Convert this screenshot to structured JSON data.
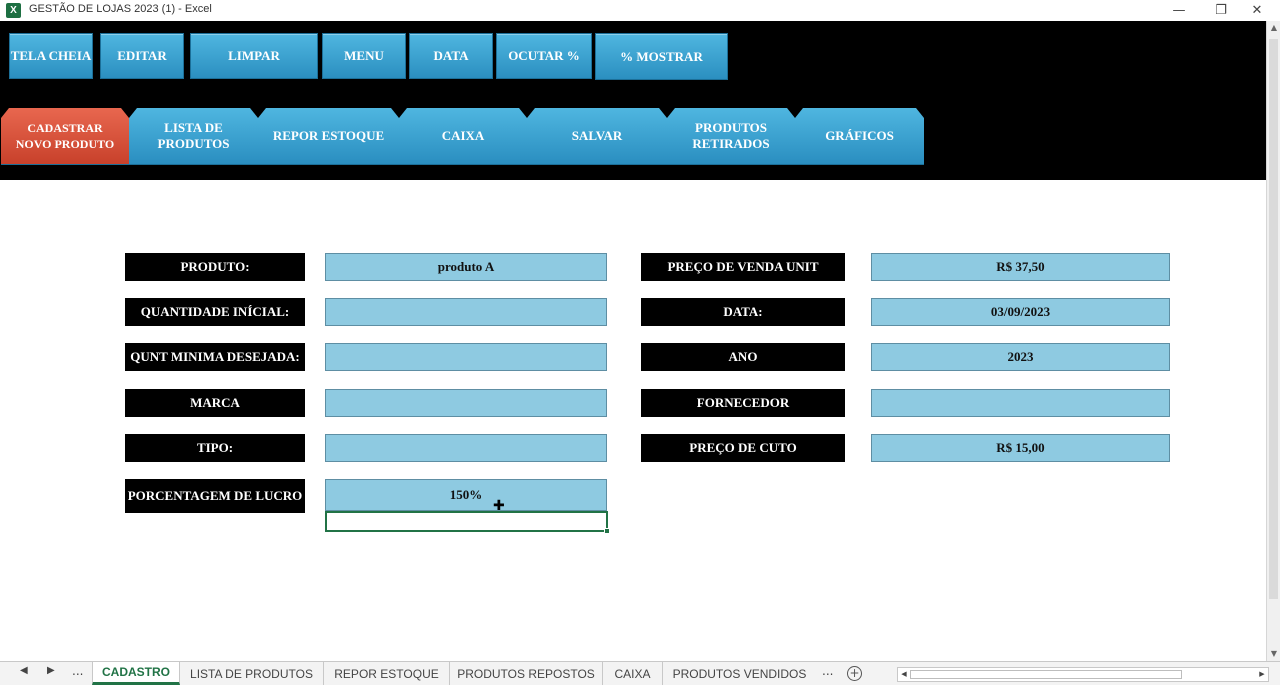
{
  "window": {
    "title": "GESTÃO DE LOJAS 2023 (1) - Excel",
    "app_icon": "excel-icon",
    "minimize": "—",
    "restore": "❐",
    "close": "✕"
  },
  "toolbar": {
    "tela_cheia": "TELA CHEIA",
    "editar": "EDITAR",
    "limpar": "LIMPAR",
    "menu": "MENU",
    "data": "DATA",
    "ocutar": "OCUTAR %",
    "mostrar": "% MOSTRAR"
  },
  "tabs": {
    "cadastrar": "CADASTRAR NOVO PRODUTO",
    "lista": "LISTA DE PRODUTOS",
    "repor": "REPOR ESTOQUE",
    "caixa": "CAIXA",
    "salvar": "SALVAR",
    "retirados": "PRODUTOS RETIRADOS",
    "graficos": "GRÁFICOS"
  },
  "form": {
    "produto_label": "PRODUTO:",
    "produto_value": "produto A",
    "quantidade_label": "QUANTIDADE INÍCIAL:",
    "quantidade_value": "",
    "qunt_minima_label": "QUNT MINIMA DESEJADA:",
    "qunt_minima_value": "",
    "marca_label": "MARCA",
    "marca_value": "",
    "tipo_label": "TIPO:",
    "tipo_value": "",
    "porcentagem_label": "PORCENTAGEM DE LUCRO",
    "porcentagem_value": "150%",
    "preco_venda_label": "PREÇO DE VENDA UNIT",
    "preco_venda_value": "R$ 37,50",
    "data_label": "DATA:",
    "data_value": "03/09/2023",
    "ano_label": "ANO",
    "ano_value": "2023",
    "fornecedor_label": "FORNECEDOR",
    "fornecedor_value": "",
    "preco_custo_label": "PREÇO DE CUTO",
    "preco_custo_value": "R$ 15,00"
  },
  "sheets": {
    "ellipsis": "...",
    "tabs": [
      "CADASTRO",
      "LISTA DE PRODUTOS",
      "REPOR ESTOQUE",
      "PRODUTOS REPOSTOS",
      "CAIXA",
      "PRODUTOS VENDIDOS"
    ],
    "more": "...",
    "add": "+"
  },
  "colors": {
    "tab_blue": "#3aa3d3",
    "tab_active": "#d9533c",
    "field_fill": "#8ecae1",
    "label_bg": "#000000",
    "excel_green": "#217346"
  }
}
